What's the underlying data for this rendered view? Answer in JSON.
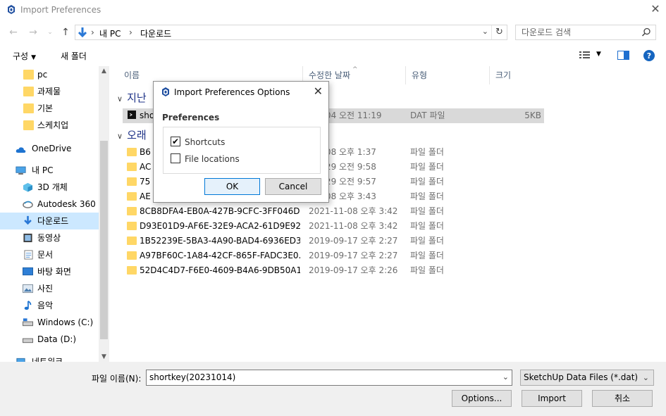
{
  "window": {
    "title": "Import Preferences",
    "close_glyph": "✕"
  },
  "address": {
    "crumbs": [
      "내 PC",
      "다운로드"
    ],
    "search_placeholder": "다운로드 검색"
  },
  "toolbar": {
    "organize": "구성",
    "new_folder": "새 폴더"
  },
  "sidebar": {
    "items": [
      {
        "label": "pc",
        "icon": "folder-icon"
      },
      {
        "label": "과제물",
        "icon": "folder-icon"
      },
      {
        "label": "기본",
        "icon": "folder-icon"
      },
      {
        "label": "스케치업",
        "icon": "folder-icon"
      },
      {
        "label": "OneDrive",
        "icon": "cloud-icon"
      },
      {
        "label": "내 PC",
        "icon": "computer-icon"
      },
      {
        "label": "3D 개체",
        "icon": "cube-icon"
      },
      {
        "label": "Autodesk 360",
        "icon": "autodesk-icon"
      },
      {
        "label": "다운로드",
        "icon": "download-icon"
      },
      {
        "label": "동영상",
        "icon": "video-icon"
      },
      {
        "label": "문서",
        "icon": "document-icon"
      },
      {
        "label": "바탕 화면",
        "icon": "desktop-icon"
      },
      {
        "label": "사진",
        "icon": "picture-icon"
      },
      {
        "label": "음악",
        "icon": "music-icon"
      },
      {
        "label": "Windows (C:)",
        "icon": "drive-icon"
      },
      {
        "label": "Data (D:)",
        "icon": "drive-icon"
      },
      {
        "label": "네트워크",
        "icon": "network-icon"
      }
    ]
  },
  "columns": {
    "name": "이름",
    "date": "수정한 날짜",
    "type": "유형",
    "size": "크기"
  },
  "groups": {
    "last": "지난",
    "old": "오래"
  },
  "files": [
    {
      "name": "sho",
      "date": "-06-04 오전 11:19",
      "type": "DAT 파일",
      "size": "5KB"
    },
    {
      "name": "B6",
      "date": "-09-08 오후 1:37",
      "type": "파일 폴더",
      "size": ""
    },
    {
      "name": "AC",
      "date": "-08-29 오전 9:58",
      "type": "파일 폴더",
      "size": ""
    },
    {
      "name": "75",
      "date": "-08-29 오전 9:57",
      "type": "파일 폴더",
      "size": ""
    },
    {
      "name": "AE",
      "date": "-11-08 오후 3:43",
      "type": "파일 폴더",
      "size": ""
    },
    {
      "name": "8CB8DFA4-EB0A-427B-9CFC-3FF046D...",
      "date": "2021-11-08 오후 3:42",
      "type": "파일 폴더",
      "size": ""
    },
    {
      "name": "D93E01D9-AF6E-32E9-ACA2-61D9E92...",
      "date": "2021-11-08 오후 3:42",
      "type": "파일 폴더",
      "size": ""
    },
    {
      "name": "1B52239E-5BA3-4A90-BAD4-6936ED3...",
      "date": "2019-09-17 오후 2:27",
      "type": "파일 폴더",
      "size": ""
    },
    {
      "name": "A97BF60C-1A84-42CF-865F-FADC3E0...",
      "date": "2019-09-17 오후 2:27",
      "type": "파일 폴더",
      "size": ""
    },
    {
      "name": "52D4C4D7-F6E0-4609-B4A6-9DB50A1...",
      "date": "2019-09-17 오후 2:26",
      "type": "파일 폴더",
      "size": ""
    }
  ],
  "bottom": {
    "filename_label": "파일 이름(N):",
    "filename_value": "shortkey(20231014)",
    "filter": "SketchUp Data Files (*.dat)",
    "options": "Options...",
    "import": "Import",
    "cancel": "취소"
  },
  "dialog": {
    "title": "Import Preferences Options",
    "group": "Preferences",
    "shortcuts": {
      "label": "Shortcuts",
      "checked": true
    },
    "file_locations": {
      "label": "File locations",
      "checked": false
    },
    "ok": "OK",
    "cancel": "Cancel"
  },
  "colors": {
    "accent": "#1a73e8",
    "selection": "#cce8ff",
    "group_text": "#1e3287"
  }
}
